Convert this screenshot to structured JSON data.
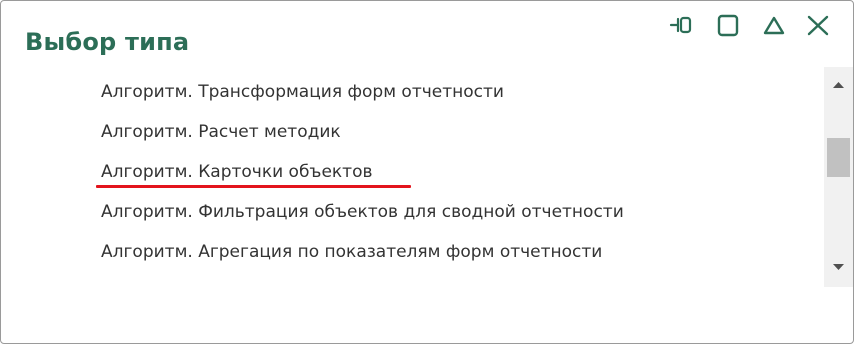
{
  "dialog": {
    "title": "Выбор типа"
  },
  "window_controls": [
    {
      "name": "pin-icon",
      "label": "pin"
    },
    {
      "name": "maximize-icon",
      "label": "maximize"
    },
    {
      "name": "collapse-icon",
      "label": "collapse"
    },
    {
      "name": "close-icon",
      "label": "close"
    }
  ],
  "list": {
    "items": [
      {
        "label": "Алгоритм. Трансформация форм отчетности"
      },
      {
        "label": "Алгоритм. Расчет методик"
      },
      {
        "label": "Алгоритм. Карточки объектов",
        "highlighted": true
      },
      {
        "label": "Алгоритм. Фильтрация объектов для сводной отчетности"
      },
      {
        "label": "Алгоритм. Агрегация по показателям форм отчетности"
      }
    ]
  },
  "colors": {
    "title": "#2c6e57",
    "icons": "#2c6e57",
    "highlight_underline": "#e3141c",
    "text": "#333333",
    "scroll_track": "#f1f1f1",
    "scroll_thumb": "#c1c1c1"
  }
}
